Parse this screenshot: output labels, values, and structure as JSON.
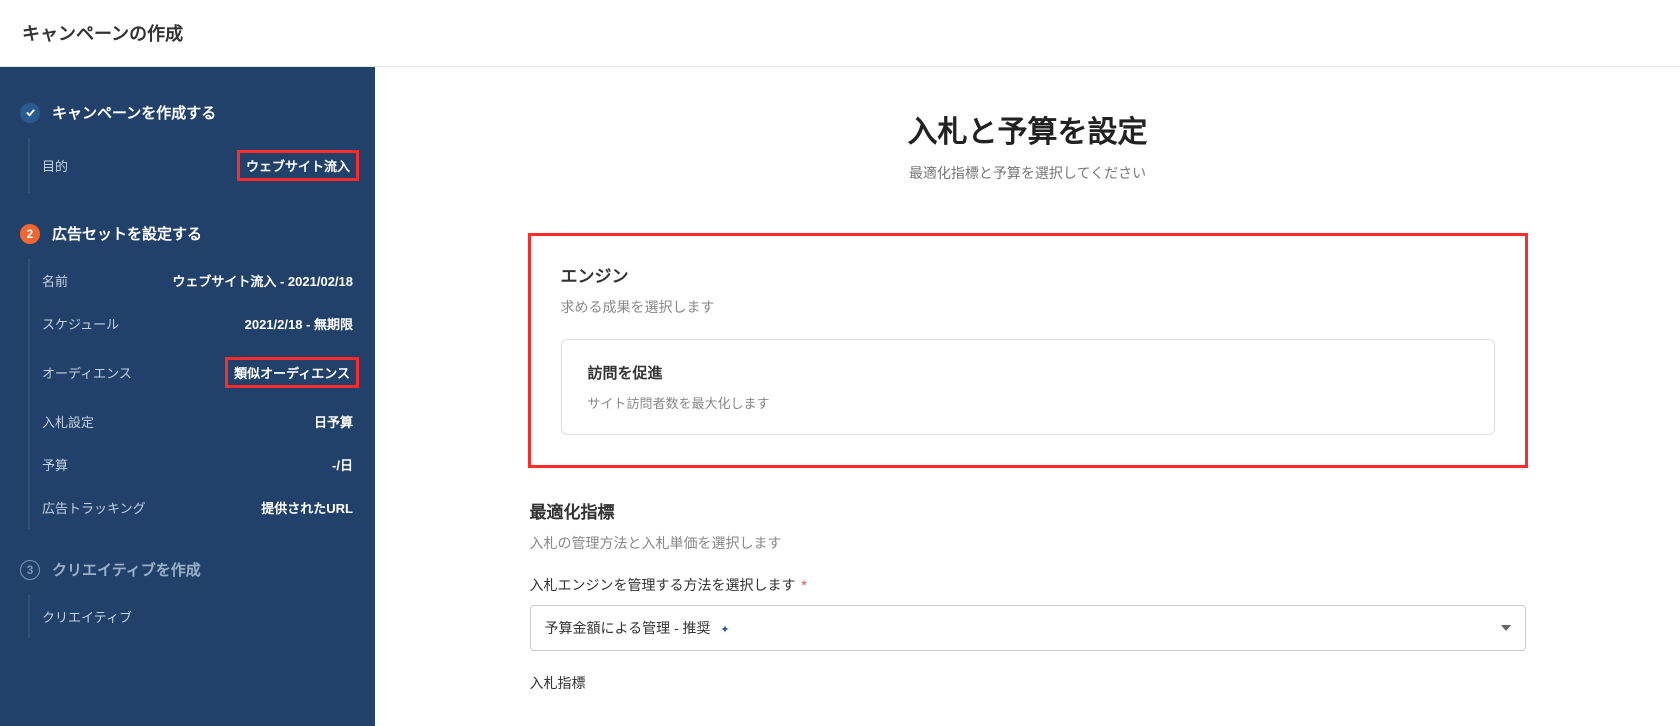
{
  "topbar": {
    "title": "キャンペーンの作成"
  },
  "sidebar": {
    "step1": {
      "title": "キャンペーンを作成する",
      "items": [
        {
          "label": "目的",
          "value": "ウェブサイト流入",
          "highlight": true
        }
      ]
    },
    "step2": {
      "badge": "2",
      "title": "広告セットを設定する",
      "items": [
        {
          "label": "名前",
          "value": "ウェブサイト流入 - 2021/02/18",
          "highlight": false
        },
        {
          "label": "スケジュール",
          "value": "2021/2/18 - 無期限",
          "highlight": false
        },
        {
          "label": "オーディエンス",
          "value": "類似オーディエンス",
          "highlight": true
        },
        {
          "label": "入札設定",
          "value": "日予算",
          "highlight": false
        },
        {
          "label": "予算",
          "value": "-/日",
          "highlight": false
        },
        {
          "label": "広告トラッキング",
          "value": "提供されたURL",
          "highlight": false
        }
      ]
    },
    "step3": {
      "badge": "3",
      "title": "クリエイティブを作成",
      "items": [
        {
          "label": "クリエイティブ",
          "value": "",
          "highlight": false
        }
      ]
    }
  },
  "main": {
    "title": "入札と予算を設定",
    "subtitle": "最適化指標と予算を選択してください",
    "engine": {
      "title": "エンジン",
      "desc": "求める成果を選択します",
      "card_title": "訪問を促進",
      "card_desc": "サイト訪問者数を最大化します"
    },
    "optimization": {
      "title": "最適化指標",
      "desc": "入札の管理方法と入札単価を選択します",
      "method_label": "入札エンジンを管理する方法を選択します",
      "method_value": "予算金額による管理 - 推奨",
      "bid_label": "入札指標"
    }
  }
}
